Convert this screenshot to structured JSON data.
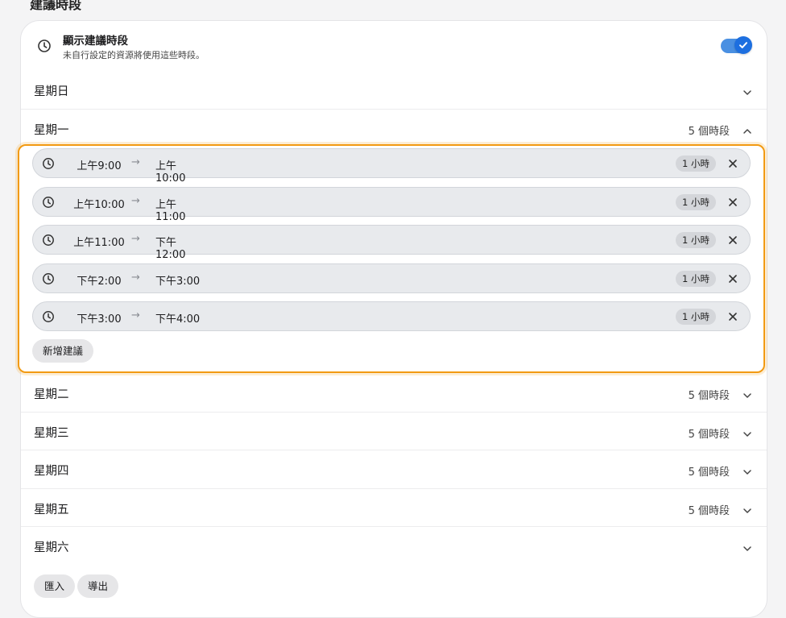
{
  "section_title": "建議時段",
  "toggle": {
    "title": "顯示建議時段",
    "description": "未自行設定的資源將使用這些時段。",
    "enabled": true
  },
  "days": [
    {
      "label": "星期日",
      "count": ""
    },
    {
      "label": "星期一",
      "count": "5 個時段",
      "expanded": true
    },
    {
      "label": "星期二",
      "count": "5 個時段"
    },
    {
      "label": "星期三",
      "count": "5 個時段"
    },
    {
      "label": "星期四",
      "count": "5 個時段"
    },
    {
      "label": "星期五",
      "count": "5 個時段"
    },
    {
      "label": "星期六",
      "count": ""
    }
  ],
  "slots": [
    {
      "start": "上午9:00",
      "end": "上午10:00",
      "duration": "1 小時"
    },
    {
      "start": "上午10:00",
      "end": "上午11:00",
      "duration": "1 小時"
    },
    {
      "start": "上午11:00",
      "end": "下午12:00",
      "duration": "1 小時"
    },
    {
      "start": "下午2:00",
      "end": "下午3:00",
      "duration": "1 小時"
    },
    {
      "start": "下午3:00",
      "end": "下午4:00",
      "duration": "1 小時"
    }
  ],
  "arrow_glyph": "→",
  "add_label": "新增建議",
  "import_label": "匯入",
  "export_label": "導出",
  "colors": {
    "accent": "#1d6fe0",
    "highlight": "#f29a12"
  }
}
